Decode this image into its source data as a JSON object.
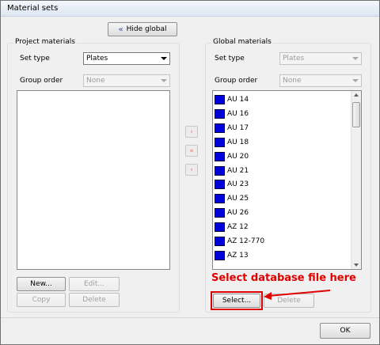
{
  "window": {
    "title": "Material sets"
  },
  "header": {
    "hide_global_label": "Hide global",
    "hide_global_icon": "double-chevron-left-icon"
  },
  "project": {
    "group_label": "Project materials",
    "set_type_label": "Set type",
    "set_type_value": "Plates",
    "group_order_label": "Group order",
    "group_order_value": "None",
    "buttons": {
      "new": "New...",
      "edit": "Edit...",
      "copy": "Copy",
      "delete": "Delete"
    }
  },
  "global": {
    "group_label": "Global materials",
    "set_type_label": "Set type",
    "set_type_value": "Plates",
    "group_order_label": "Group order",
    "group_order_value": "None",
    "items": [
      "AU 14",
      "AU 16",
      "AU 17",
      "AU 18",
      "AU 20",
      "AU 21",
      "AU 23",
      "AU 25",
      "AU 26",
      "AZ 12",
      "AZ 12-770",
      "AZ 13"
    ],
    "item_color": "#0000d8",
    "buttons": {
      "select": "Select...",
      "delete": "Delete"
    }
  },
  "transfer": {
    "copy_right": "›",
    "copy_all_right": "»",
    "copy_left": "‹"
  },
  "annotation": {
    "text": "Select database file here",
    "color": "#e00000"
  },
  "footer": {
    "ok_label": "OK"
  }
}
